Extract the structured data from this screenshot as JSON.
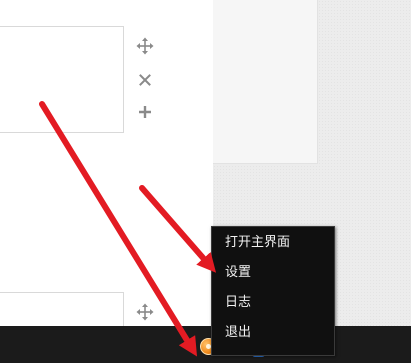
{
  "context_menu": {
    "items": [
      {
        "label": "打开主界面"
      },
      {
        "label": "设置"
      },
      {
        "label": "日志"
      },
      {
        "label": "退出"
      }
    ]
  },
  "toolbar_icons": [
    "move-icon",
    "close-icon",
    "plus-icon",
    "move-icon"
  ],
  "tray": {
    "network_text": "//…",
    "icons": [
      "tray-app-icon",
      "network-icon",
      "shield-icon",
      "flag-icon"
    ]
  },
  "colors": {
    "arrow": "#e31b23",
    "menu_background": "#101010",
    "menu_text": "#f2f2f2",
    "taskbar": "#1b1b1b",
    "tray_app": "#f08a1c"
  }
}
